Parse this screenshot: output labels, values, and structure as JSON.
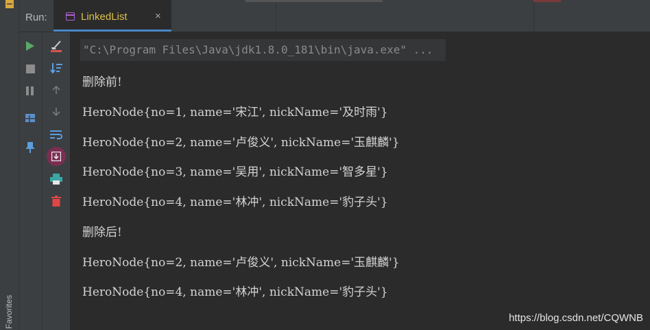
{
  "sidebar": {
    "favorites_label": "Favorites"
  },
  "header": {
    "run_label": "Run:",
    "tab": {
      "label": "LinkedList",
      "close": "×"
    }
  },
  "toolbar_left": [
    {
      "name": "rerun-icon",
      "glyph": "▶",
      "color": "#59a869"
    },
    {
      "name": "stop-icon",
      "glyph": "■",
      "color": "#9c9c9c"
    },
    {
      "name": "pause-icon",
      "glyph": "❚❚",
      "color": "#9c9c9c"
    },
    {
      "name": "layout-icon",
      "glyph": "▦",
      "color": "#6ea3d8"
    },
    {
      "name": "pin-icon",
      "glyph": "📌",
      "color": "#5c9ee0"
    }
  ],
  "toolbar_right": [
    {
      "name": "clear-console-icon",
      "color": "#d9534f"
    },
    {
      "name": "sort-icon",
      "color": "#5c9ee0"
    },
    {
      "name": "up-arrow-icon",
      "color": "#7a7a7a"
    },
    {
      "name": "down-arrow-icon",
      "color": "#7a7a7a"
    },
    {
      "name": "soft-wrap-icon",
      "color": "#5c9ee0"
    },
    {
      "name": "scroll-to-end-icon",
      "color": "#c75480"
    },
    {
      "name": "print-icon",
      "color": "#3aa6a6"
    },
    {
      "name": "trash-icon",
      "color": "#e04646"
    }
  ],
  "console": {
    "command": "\"C:\\Program Files\\Java\\jdk1.8.0_181\\bin\\java.exe\" ...",
    "lines": [
      "删除前!",
      "HeroNode{no=1, name='宋江', nickName='及时雨'}",
      "HeroNode{no=2, name='卢俊义', nickName='玉麒麟'}",
      "HeroNode{no=3, name='吴用', nickName='智多星'}",
      "HeroNode{no=4, name='林冲', nickName='豹子头'}",
      "删除后!",
      "HeroNode{no=2, name='卢俊义', nickName='玉麒麟'}",
      "HeroNode{no=4, name='林冲', nickName='豹子头'}"
    ]
  },
  "watermark": "https://blog.csdn.net/CQWNB"
}
